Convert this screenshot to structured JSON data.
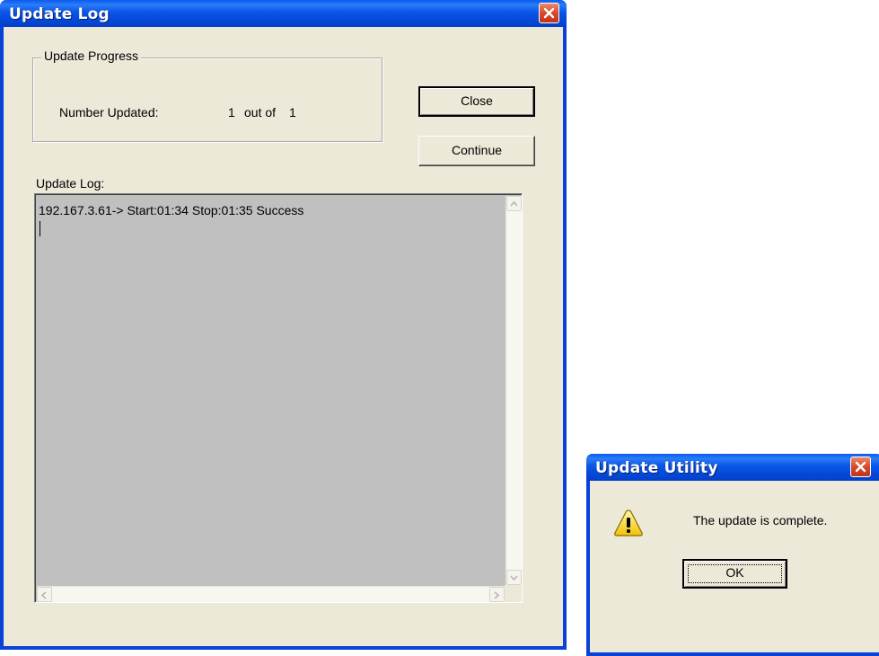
{
  "log_window": {
    "title": "Update Log",
    "progress_group": {
      "legend": "Update Progress",
      "number_label": "Number Updated:",
      "updated_count": "1",
      "out_of_label": "out of",
      "total_count": "1"
    },
    "buttons": {
      "close_label": "Close",
      "continue_label": "Continue"
    },
    "log_label": "Update Log:",
    "log_lines": [
      "192.167.3.61-> Start:01:34 Stop:01:35  Success"
    ]
  },
  "utility_dialog": {
    "title": "Update Utility",
    "message": "The update is complete.",
    "ok_label": "OK"
  },
  "colors": {
    "titlebar": "#0a56e8",
    "dialog_face": "#ece9d8",
    "log_background": "#c0c0c0",
    "close_button": "#d8492a"
  },
  "icons": {
    "close": "close-icon",
    "warning": "warning-icon",
    "scroll_up": "arrow-up-icon",
    "scroll_down": "arrow-down-icon",
    "scroll_left": "arrow-left-icon",
    "scroll_right": "arrow-right-icon"
  }
}
